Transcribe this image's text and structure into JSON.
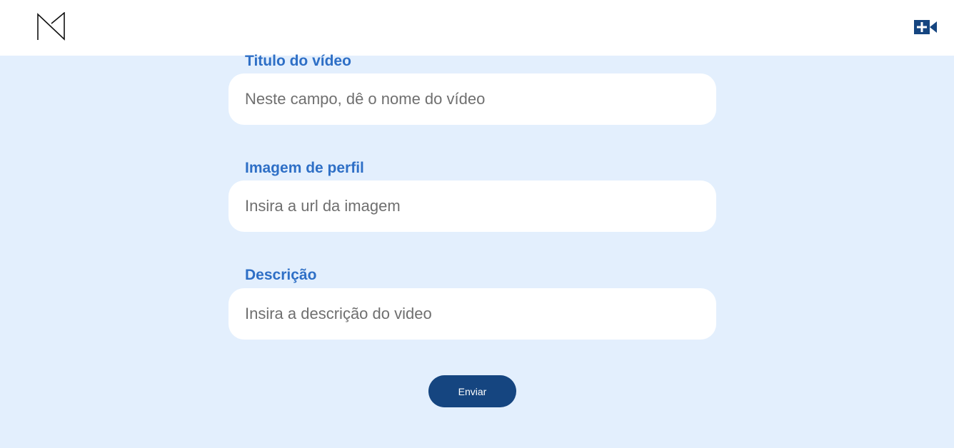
{
  "header": {
    "logo_icon": "m-logo-icon",
    "new_video_icon": "video-camera-plus-icon",
    "brand_color": "#154580"
  },
  "form": {
    "title_field": {
      "label": "Titulo do vídeo",
      "placeholder": "Neste campo, dê o nome do vídeo",
      "value": ""
    },
    "image_field": {
      "label": "Imagem de perfil",
      "placeholder": "Insira a url da imagem",
      "value": ""
    },
    "description_field": {
      "label": "Descrição",
      "placeholder": "Insira a descrição do video",
      "value": ""
    },
    "submit_label": "Enviar"
  },
  "colors": {
    "background": "#e3effd",
    "label": "#2e6fc6",
    "button": "#154580"
  }
}
